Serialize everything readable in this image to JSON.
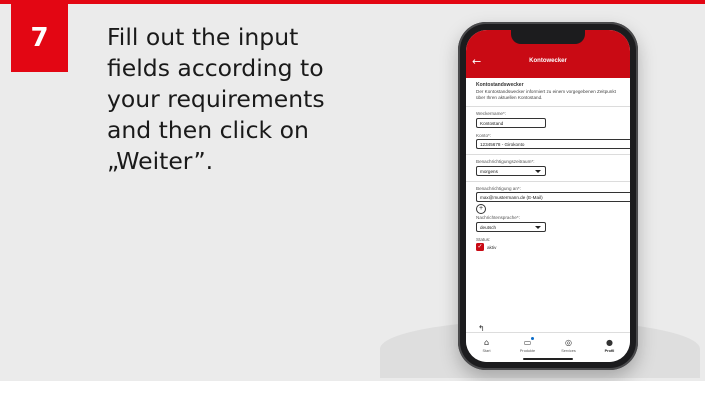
{
  "step": {
    "number": "7"
  },
  "instruction": "Fill out the input fields according to your requirements and then click on „Weiter”.",
  "app": {
    "title": "Kontowecker",
    "section_title": "Kontostandswecker",
    "intro": "Der Kontostandswecker informiert zu einem vorgegebenen Zeitpunkt über Ihren aktuellen Kontostand.",
    "fields": {
      "alarm_name": {
        "label": "Weckername*:",
        "value": "Kontostand"
      },
      "account": {
        "label": "Konto*:",
        "value": "12345678 - Girokonto"
      },
      "period": {
        "label": "Benachrichtigungszeitraum*:",
        "value": "morgens"
      },
      "notify": {
        "label": "Benachrichtigung an*:",
        "value": "max@mustermann.de (E-Mail)"
      },
      "language": {
        "label": "Nachrichtensprache*:",
        "value": "deutsch"
      },
      "status": {
        "label": "Status:",
        "value": "aktiv"
      }
    }
  },
  "tabbar": {
    "items": [
      {
        "label": "Start",
        "icon": "home-icon"
      },
      {
        "label": "Produkte",
        "icon": "products-icon"
      },
      {
        "label": "Services",
        "icon": "services-icon"
      },
      {
        "label": "Profil",
        "icon": "profile-icon"
      }
    ]
  },
  "colors": {
    "accent": "#e30613",
    "header": "#c90a14",
    "background": "#ebebeb"
  }
}
